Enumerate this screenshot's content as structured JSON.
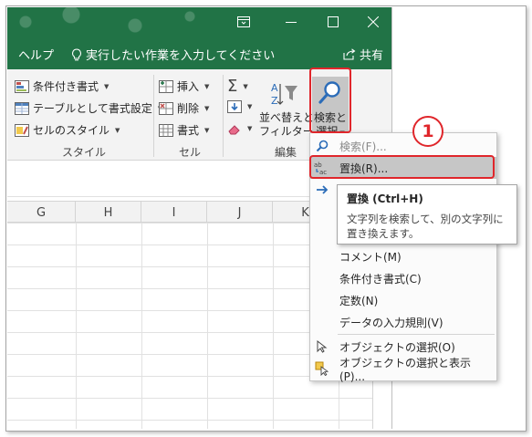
{
  "window": {
    "help_tab": "ヘルプ",
    "tell_me": "実行したい作業を入力してください",
    "share": "共有"
  },
  "ribbon": {
    "styles": {
      "items": [
        "条件付き書式",
        "テーブルとして書式設定",
        "セルのスタイル"
      ],
      "label": "スタイル"
    },
    "cells": {
      "items": [
        "挿入",
        "削除",
        "書式"
      ],
      "label": "セル"
    },
    "editing": {
      "sort_filter": [
        "並べ替えと",
        "フィルター"
      ],
      "find_select": [
        "検索と",
        "選択"
      ],
      "label": "編集"
    }
  },
  "grid": {
    "columns": [
      "G",
      "H",
      "I",
      "J",
      "K"
    ]
  },
  "menu": {
    "items": [
      {
        "label": "検索(F)...",
        "icon": "search-icon",
        "state": "disabled"
      },
      {
        "label": "置換(R)...",
        "icon": "replace-icon",
        "state": "hover"
      },
      {
        "label": "",
        "icon": "arrow-right-icon",
        "state": "normal"
      },
      {
        "label": "コメント(M)",
        "icon": "",
        "state": "normal"
      },
      {
        "label": "条件付き書式(C)",
        "icon": "",
        "state": "normal"
      },
      {
        "label": "定数(N)",
        "icon": "",
        "state": "normal"
      },
      {
        "label": "データの入力規則(V)",
        "icon": "",
        "state": "normal"
      },
      {
        "label": "オブジェクトの選択(O)",
        "icon": "cursor-icon",
        "state": "normal"
      },
      {
        "label": "オブジェクトの選択と表示(P)...",
        "icon": "selection-pane-icon",
        "state": "normal"
      }
    ]
  },
  "tooltip": {
    "title": "置換 (Ctrl+H)",
    "body": "文字列を検索して、別の文字列に置き換えます。"
  },
  "annotation": {
    "step_number": "1"
  },
  "colors": {
    "excel_green": "#217346",
    "highlight_red": "#e0262b"
  }
}
